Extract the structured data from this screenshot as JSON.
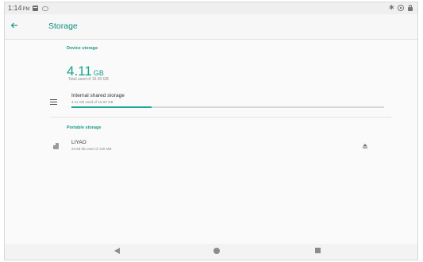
{
  "status_bar": {
    "time": "1:14",
    "ampm": "PM"
  },
  "app_bar": {
    "title": "Storage"
  },
  "device_storage": {
    "header": "Device storage",
    "used_value": "4.11",
    "used_unit": "GB",
    "total_text": "Total used of 16.00 GB",
    "internal": {
      "title": "Internal shared storage",
      "subtitle": "4.11 GB used of 16.00 GB",
      "used_fraction": 0.257
    }
  },
  "portable_storage": {
    "header": "Portable storage",
    "device": {
      "title": "LIYAO",
      "subtitle": "24.58 kB used of 125 MB"
    }
  },
  "colors": {
    "accent": "#1fa898",
    "title": "#0b8f7e"
  }
}
